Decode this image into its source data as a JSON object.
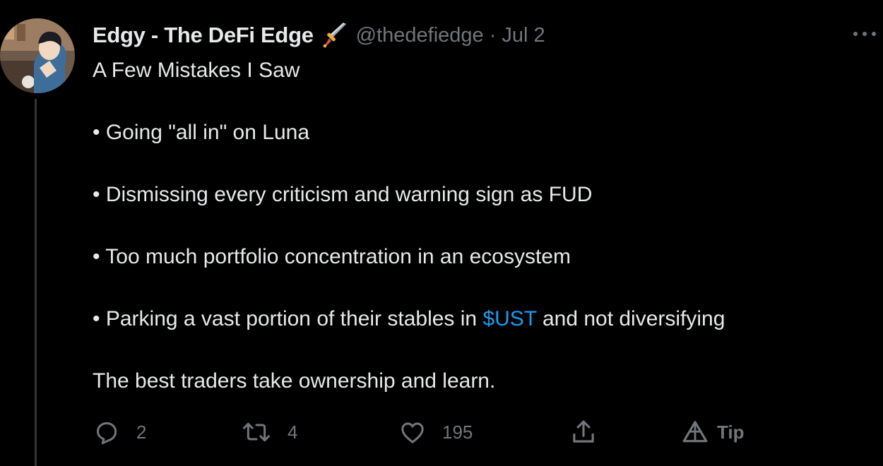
{
  "tweet": {
    "author_name": "Edgy - The DeFi Edge",
    "handle": "@thedefiedge",
    "separator": "·",
    "time": "Jul 2",
    "lines": {
      "title": "A Few Mistakes I Saw",
      "bullet1": "• Going \"all in\" on Luna",
      "bullet2": "• Dismissing every criticism and warning sign as FUD",
      "bullet3": "• Too much portfolio concentration in an ecosystem",
      "bullet4_before": "• Parking a vast portion of their stables in ",
      "bullet4_cashtag": "$UST",
      "bullet4_after": " and not diversifying",
      "closing": "The best traders take ownership and learn."
    }
  },
  "actions": {
    "reply_count": "2",
    "retweet_count": "4",
    "like_count": "195",
    "tip_label": "Tip"
  },
  "colors": {
    "background": "#000000",
    "text": "#e7e9ea",
    "secondary": "#71767b",
    "link": "#1d9bf0",
    "thread_line": "#333639"
  },
  "icons": {
    "avatar": "avatar-illustration",
    "emoji": "dagger-emoji",
    "more": "more-dots-icon",
    "reply": "reply-bubble-icon",
    "retweet": "retweet-icon",
    "like": "heart-icon",
    "share": "share-icon",
    "tip": "tip-triangle-icon"
  }
}
